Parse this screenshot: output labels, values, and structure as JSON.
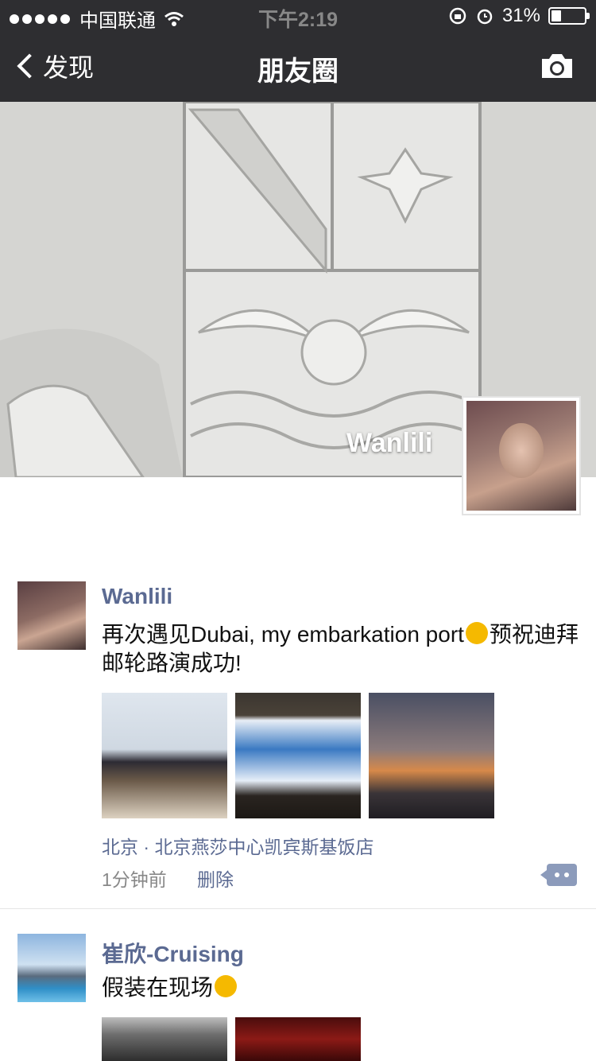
{
  "status_bar": {
    "carrier": "中国联通",
    "time": "下午2:19",
    "battery_percent": "31%",
    "battery_level": 0.31
  },
  "nav": {
    "back_label": "发现",
    "title": "朋友圈"
  },
  "cover": {
    "name": "Wanlili"
  },
  "posts": [
    {
      "name": "Wanlili",
      "text_before": "再次遇见Dubai, my embarkation port",
      "text_after": "预祝迪拜邮轮路演成功!",
      "location": "北京 · 北京燕莎中心凯宾斯基饭店",
      "time": "1分钟前",
      "delete_label": "删除"
    },
    {
      "name": "崔欣-Cruising",
      "text": "假装在现场"
    }
  ],
  "colors": {
    "link": "#5b6a92",
    "nav_bg": "#2e2e31"
  },
  "icons": [
    "back-chevron-icon",
    "camera-icon",
    "wifi-icon",
    "lock-rotation-icon",
    "alarm-icon",
    "battery-icon",
    "comment-more-icon"
  ]
}
